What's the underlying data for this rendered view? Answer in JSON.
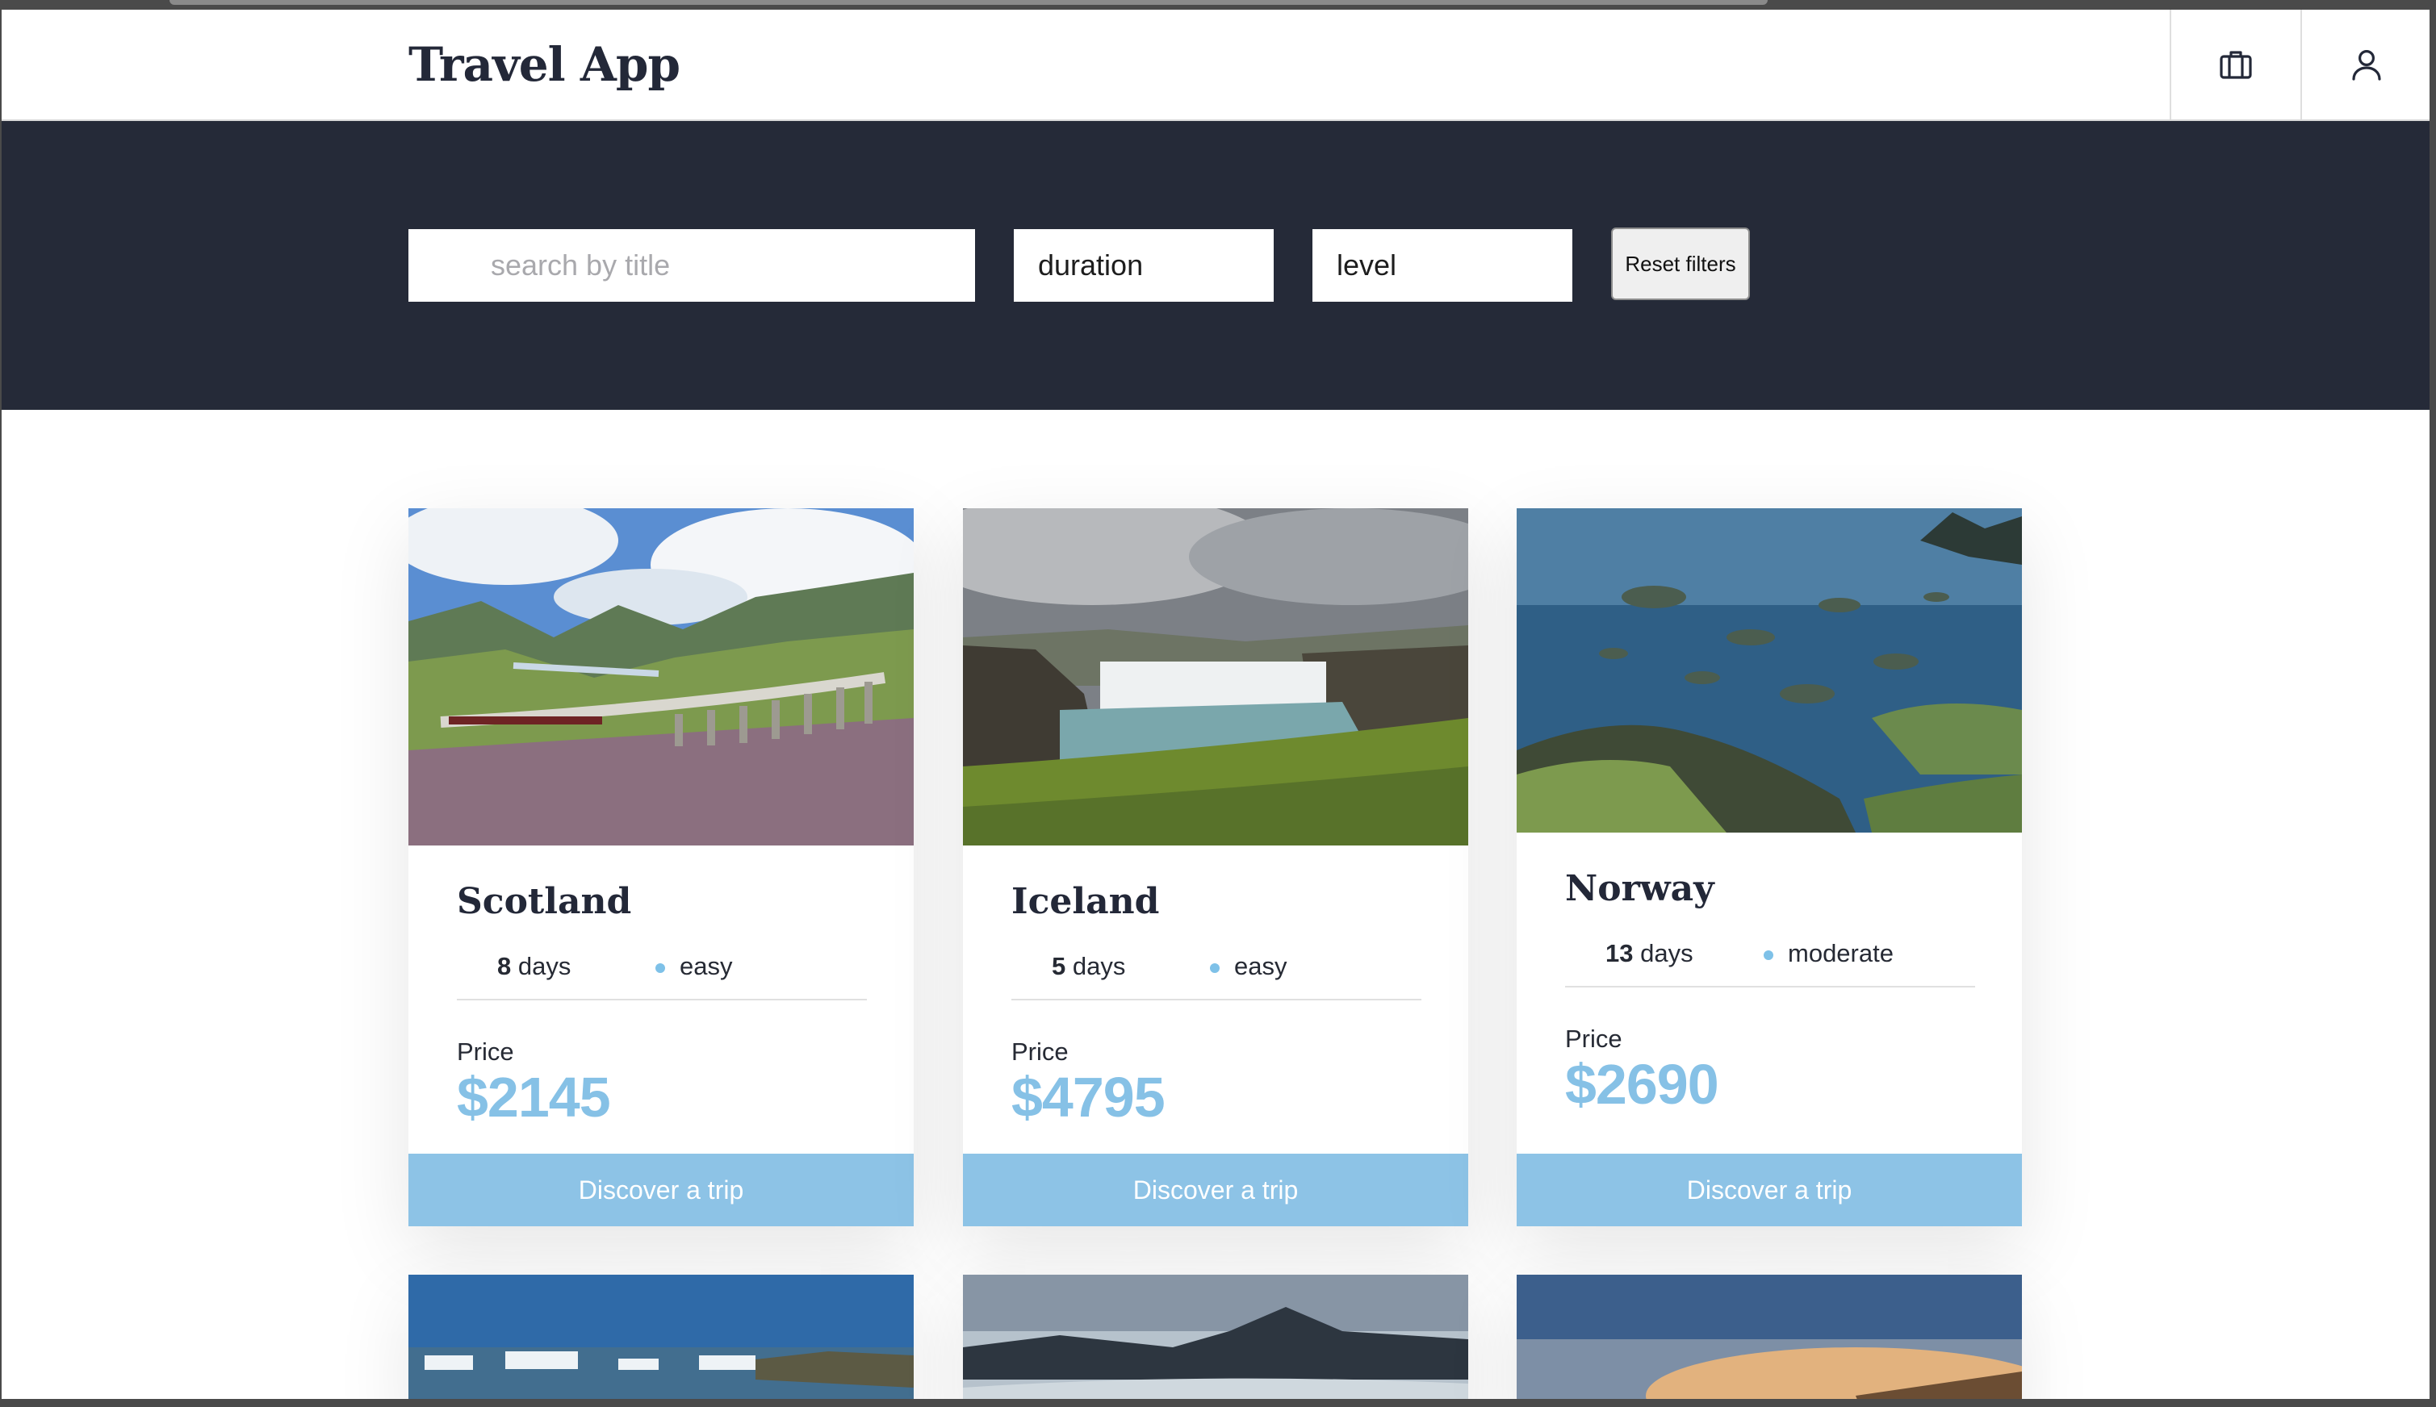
{
  "app": {
    "title": "Travel App"
  },
  "header": {
    "trips_icon": "briefcase-icon",
    "profile_icon": "user-icon"
  },
  "filters": {
    "search_placeholder": "search by title",
    "duration_value": "duration",
    "level_value": "level",
    "reset_label": "Reset filters"
  },
  "trips": [
    {
      "title": "Scotland",
      "days": "8",
      "days_unit": "days",
      "level": "easy",
      "price_label": "Price",
      "price": "$2145",
      "cta": "Discover a trip"
    },
    {
      "title": "Iceland",
      "days": "5",
      "days_unit": "days",
      "level": "easy",
      "price_label": "Price",
      "price": "$4795",
      "cta": "Discover a trip"
    },
    {
      "title": "Norway",
      "days": "13",
      "days_unit": "days",
      "level": "moderate",
      "price_label": "Price",
      "price": "$2690",
      "cta": "Discover a trip"
    }
  ],
  "colors": {
    "brand_dark": "#252a38",
    "accent": "#8dc3e6",
    "price": "#86c1e6"
  }
}
